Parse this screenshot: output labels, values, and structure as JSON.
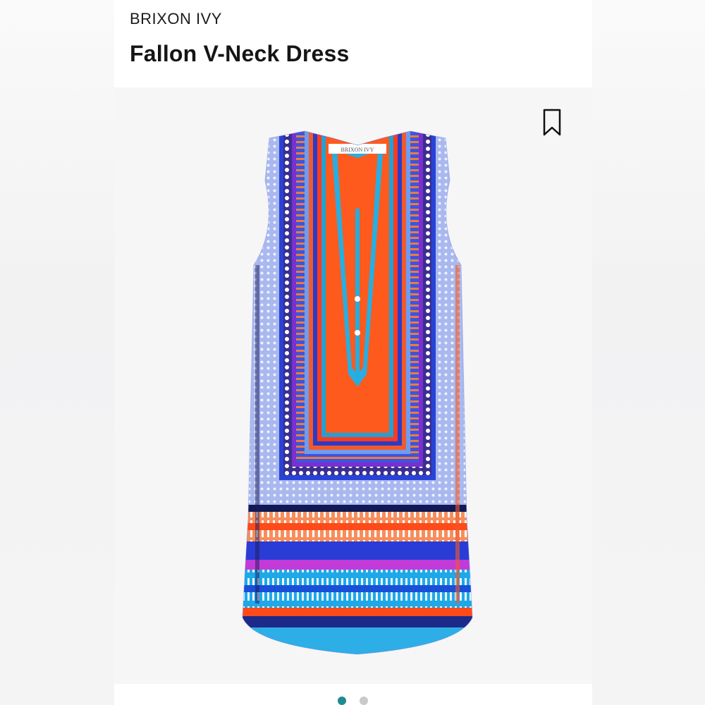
{
  "product": {
    "brand": "BRIXON IVY",
    "name": "Fallon V-Neck Dress",
    "label_text": "BRIXON IVY"
  },
  "gallery": {
    "slide_count": 2,
    "active_slide": 1
  },
  "icons": {
    "save": "bookmark-icon"
  },
  "colors": {
    "accent": "#1f8a8f",
    "inactive_dot": "#c9c9cb"
  }
}
